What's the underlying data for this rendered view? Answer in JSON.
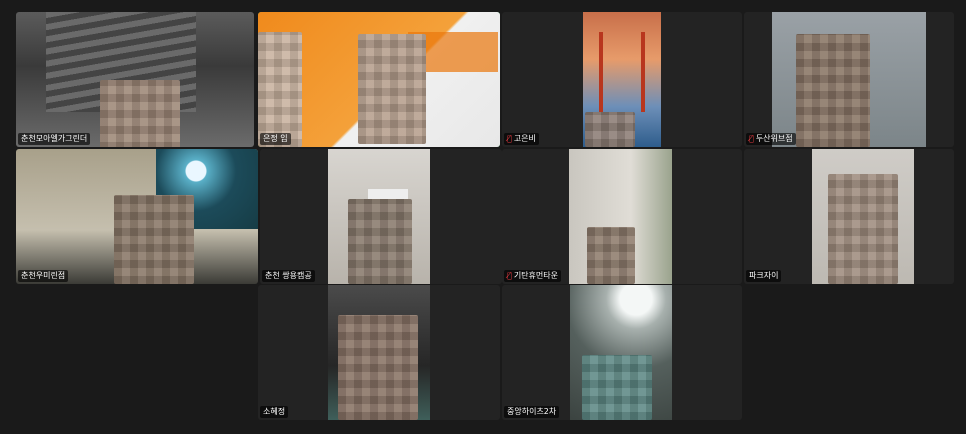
{
  "participants": [
    {
      "name": "춘천모아엘가그린더",
      "muted": false
    },
    {
      "name": "은정 임",
      "muted": false,
      "active_speaker": true
    },
    {
      "name": "고은비",
      "muted": true
    },
    {
      "name": "두산위브점",
      "muted": true
    },
    {
      "name": "춘천우미린점",
      "muted": false
    },
    {
      "name": "춘천 쌍용캠공",
      "muted": false
    },
    {
      "name": "기탄휴먼타운",
      "muted": true
    },
    {
      "name": "파크자이",
      "muted": false
    },
    {
      "name": "소혜정",
      "muted": false
    },
    {
      "name": "중앙하이츠2차",
      "muted": false
    }
  ],
  "icons": {
    "mic_muted": "mic-muted-icon"
  },
  "colors": {
    "active_speaker_border": "#2ec866",
    "muted_icon": "#e0383e",
    "background": "#1a1a1a"
  }
}
